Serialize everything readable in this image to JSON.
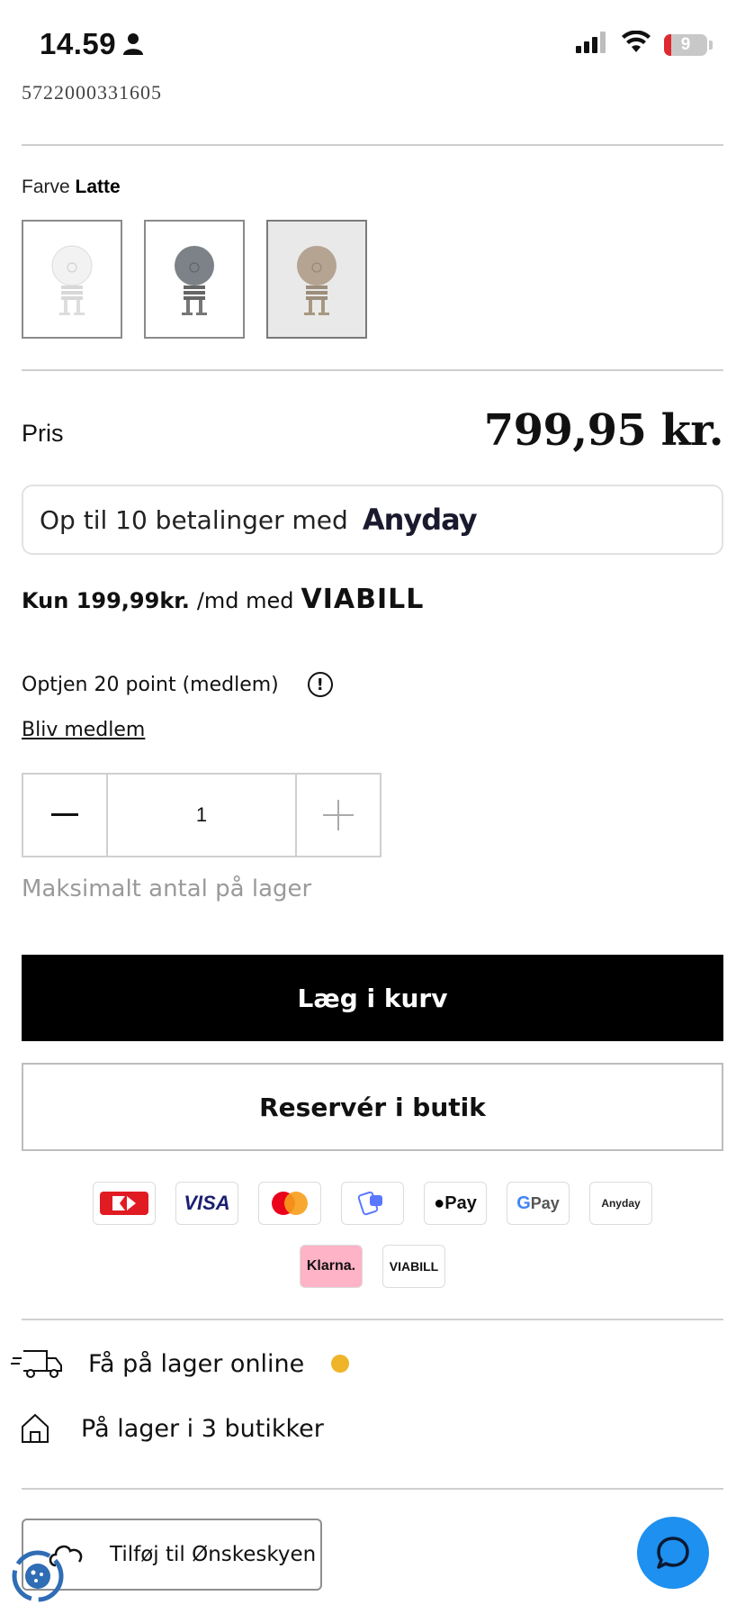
{
  "status_bar": {
    "time": "14.59",
    "battery": "9"
  },
  "product": {
    "ean": "5722000331605",
    "color_label": "Farve",
    "color_value": "Latte",
    "swatches": [
      {
        "name": "white",
        "color": "#f2f2f2"
      },
      {
        "name": "grey",
        "color": "#7c8288"
      },
      {
        "name": "latte",
        "color": "#b4a491",
        "selected": true
      }
    ],
    "price_label": "Pris",
    "price": "799,95 kr."
  },
  "anyday": {
    "text": "Op til 10 betalinger med",
    "logo": "Anyday"
  },
  "viabill": {
    "amount": "Kun 199,99kr.",
    "text": "/md med",
    "logo": "VIABILL"
  },
  "loyalty": {
    "points_text": "Optjen 20 point (medlem)",
    "member_link": "Bliv medlem"
  },
  "quantity": {
    "value": "1",
    "stock_note": "Maksimalt antal på lager"
  },
  "actions": {
    "add_to_cart": "Læg i kurv",
    "reserve": "Reservér i butik"
  },
  "payment_methods": [
    "Dankort",
    "VISA",
    "Mastercard",
    "MobilePay",
    "Apple Pay",
    "Google Pay",
    "Anyday",
    "Klarna.",
    "VIABILL"
  ],
  "payment_labels": {
    "visa": "VISA",
    "applepay": "Pay",
    "gpay": "Pay",
    "anyday": "Anyday",
    "klarna": "Klarna.",
    "viabill": "VIABILL"
  },
  "stock": {
    "online": "Få på lager online",
    "stores": "På lager i 3 butikker",
    "online_status_color": "#f0b429"
  },
  "wishlist": {
    "label": "Tilføj til Ønskeskyen"
  },
  "chat": {
    "icon": "chat-icon",
    "color": "#1e90f0"
  }
}
